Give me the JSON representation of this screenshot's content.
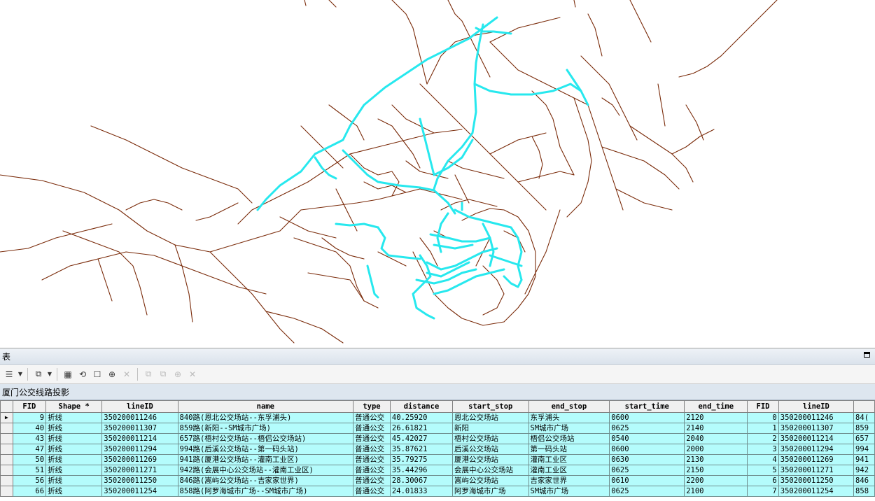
{
  "colors": {
    "road": "#7a2b0a",
    "route": "#27e8ee",
    "row_bg": "#b4fcfc"
  },
  "panel": {
    "title": "表",
    "toolbar_icons": [
      "table-options-icon",
      "related-tables-icon",
      "select-by-attributes-icon",
      "switch-selection-icon",
      "clear-selection-icon",
      "zoom-to-selected-icon",
      "delete-selected-icon",
      "copy-icon",
      "paste-icon",
      "find-icon",
      "delete-icon"
    ],
    "table_name": "厦门公交线路投影"
  },
  "table": {
    "columns": [
      "FID",
      "Shape *",
      "lineID",
      "name",
      "type",
      "distance",
      "start_stop",
      "end_stop",
      "start_time",
      "end_time",
      "FID",
      "lineID",
      ""
    ],
    "rows": [
      {
        "fid": "9",
        "shape": "折线",
        "lineID": "350200011246",
        "name": "840路(恩北公交场站--东孚浦头)",
        "type": "普通公交",
        "distance": "40.25920",
        "start_stop": "恩北公交场站",
        "end_stop": "东孚浦头",
        "start_time": "0600",
        "end_time": "2120",
        "fid2": "0",
        "lineID2": "350200011246",
        "extra": "84("
      },
      {
        "fid": "40",
        "shape": "折线",
        "lineID": "350200011307",
        "name": "859路(新阳--SM城市广场)",
        "type": "普通公交",
        "distance": "26.61821",
        "start_stop": "新阳",
        "end_stop": "SM城市广场",
        "start_time": "0625",
        "end_time": "2140",
        "fid2": "1",
        "lineID2": "350200011307",
        "extra": "859"
      },
      {
        "fid": "43",
        "shape": "折线",
        "lineID": "350200011214",
        "name": "657路(梧村公交场站--梧侣公交场站)",
        "type": "普通公交",
        "distance": "45.42027",
        "start_stop": "梧村公交场站",
        "end_stop": "梧侣公交场站",
        "start_time": "0540",
        "end_time": "2040",
        "fid2": "2",
        "lineID2": "350200011214",
        "extra": "657"
      },
      {
        "fid": "47",
        "shape": "折线",
        "lineID": "350200011294",
        "name": "994路(后溪公交场站--第一码头站)",
        "type": "普通公交",
        "distance": "35.87621",
        "start_stop": "后溪公交场站",
        "end_stop": "第一码头站",
        "start_time": "0600",
        "end_time": "2000",
        "fid2": "3",
        "lineID2": "350200011294",
        "extra": "994"
      },
      {
        "fid": "50",
        "shape": "折线",
        "lineID": "350200011269",
        "name": "941路(厦港公交场站--灌南工业区)",
        "type": "普通公交",
        "distance": "35.79275",
        "start_stop": "厦港公交场站",
        "end_stop": "灌南工业区",
        "start_time": "0630",
        "end_time": "2130",
        "fid2": "4",
        "lineID2": "350200011269",
        "extra": "941"
      },
      {
        "fid": "51",
        "shape": "折线",
        "lineID": "350200011271",
        "name": "942路(会展中心公交场站--灌南工业区)",
        "type": "普通公交",
        "distance": "35.44296",
        "start_stop": "会展中心公交场站",
        "end_stop": "灌南工业区",
        "start_time": "0625",
        "end_time": "2150",
        "fid2": "5",
        "lineID2": "350200011271",
        "extra": "942"
      },
      {
        "fid": "56",
        "shape": "折线",
        "lineID": "350200011250",
        "name": "846路(嵩屿公交场站--吉家家世界)",
        "type": "普通公交",
        "distance": "28.30067",
        "start_stop": "嵩屿公交场站",
        "end_stop": "吉家家世界",
        "start_time": "0610",
        "end_time": "2200",
        "fid2": "6",
        "lineID2": "350200011250",
        "extra": "846"
      },
      {
        "fid": "66",
        "shape": "折线",
        "lineID": "350200011254",
        "name": "858路(阿罗海城市广场--SM城市广场)",
        "type": "普通公交",
        "distance": "24.01833",
        "start_stop": "阿罗海城市广场",
        "end_stop": "SM城市广场",
        "start_time": "0625",
        "end_time": "2100",
        "fid2": "7",
        "lineID2": "350200011254",
        "extra": "858"
      }
    ]
  }
}
